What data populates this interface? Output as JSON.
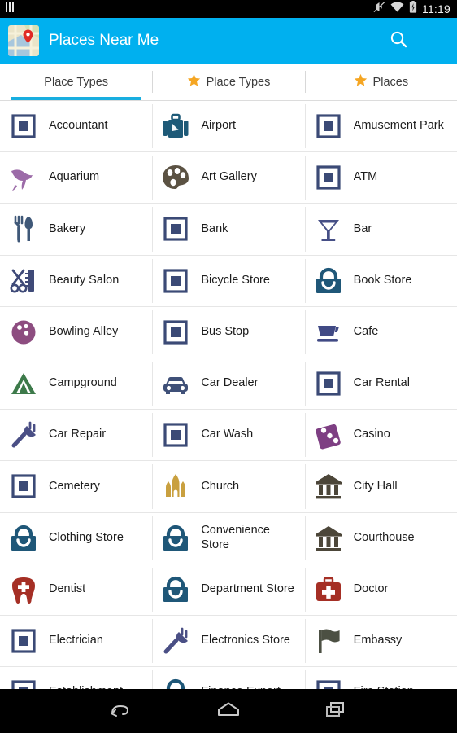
{
  "status_bar": {
    "time": "11:19",
    "icons": [
      "vibrate-muted-icon",
      "wifi-icon",
      "battery-charging-icon"
    ],
    "left_icon": "notification-bars-icon"
  },
  "app_bar": {
    "title": "Places Near Me",
    "logo_icon": "map-pin-app-icon",
    "background_color": "#00b0ef",
    "actions": [
      {
        "name": "search-button",
        "icon": "search-icon"
      },
      {
        "name": "overflow-menu-button",
        "icon": "more-vertical-icon"
      }
    ]
  },
  "tabs": {
    "active_index": 0,
    "indicator_color": "#18aee0",
    "items": [
      {
        "label": "Place Types",
        "icon": null,
        "active": true
      },
      {
        "label": "Place Types",
        "icon": "star-icon",
        "active": false
      },
      {
        "label": "Places",
        "icon": "star-icon",
        "active": false
      }
    ]
  },
  "grid": {
    "columns": 3,
    "rows": [
      [
        {
          "label": "Accountant",
          "icon": "generic-square-icon",
          "color": "#3b4a76"
        },
        {
          "label": "Airport",
          "icon": "suitcase-icon",
          "color": "#1e5a78"
        },
        {
          "label": "Amusement Park",
          "icon": "generic-square-icon",
          "color": "#3b4a76"
        }
      ],
      [
        {
          "label": "Aquarium",
          "icon": "dolphin-icon",
          "color": "#9c6ba8"
        },
        {
          "label": "Art Gallery",
          "icon": "palette-icon",
          "color": "#5b5243"
        },
        {
          "label": "ATM",
          "icon": "generic-square-icon",
          "color": "#3b4a76"
        }
      ],
      [
        {
          "label": "Bakery",
          "icon": "fork-knife-icon",
          "color": "#3f5878"
        },
        {
          "label": "Bank",
          "icon": "generic-square-icon",
          "color": "#3b4a76"
        },
        {
          "label": "Bar",
          "icon": "cocktail-glass-icon",
          "color": "#464f86"
        }
      ],
      [
        {
          "label": "Beauty Salon",
          "icon": "scissors-comb-icon",
          "color": "#3f4a78"
        },
        {
          "label": "Bicycle Store",
          "icon": "generic-square-icon",
          "color": "#3b4a76"
        },
        {
          "label": "Book Store",
          "icon": "shopping-bag-icon",
          "color": "#1f5778"
        }
      ],
      [
        {
          "label": "Bowling Alley",
          "icon": "bowling-ball-icon",
          "color": "#8d4d80"
        },
        {
          "label": "Bus Stop",
          "icon": "generic-square-icon",
          "color": "#3b4a76"
        },
        {
          "label": "Cafe",
          "icon": "coffee-cup-icon",
          "color": "#414a85"
        }
      ],
      [
        {
          "label": "Campground",
          "icon": "tent-icon",
          "color": "#3d7a4a"
        },
        {
          "label": "Car Dealer",
          "icon": "car-icon",
          "color": "#3f5078"
        },
        {
          "label": "Car Rental",
          "icon": "generic-square-icon",
          "color": "#3b4a76"
        }
      ],
      [
        {
          "label": "Car Repair",
          "icon": "power-plug-icon",
          "color": "#4a4f85"
        },
        {
          "label": "Car Wash",
          "icon": "generic-square-icon",
          "color": "#3b4a76"
        },
        {
          "label": "Casino",
          "icon": "dice-icon",
          "color": "#7e3f83"
        }
      ],
      [
        {
          "label": "Cemetery",
          "icon": "generic-square-icon",
          "color": "#3b4a76"
        },
        {
          "label": "Church",
          "icon": "church-icon",
          "color": "#c9a03f"
        },
        {
          "label": "City Hall",
          "icon": "classical-building-icon",
          "color": "#4c4639"
        }
      ],
      [
        {
          "label": "Clothing Store",
          "icon": "shopping-bag-icon",
          "color": "#1f5778"
        },
        {
          "label": "Convenience Store",
          "icon": "shopping-bag-icon",
          "color": "#1f5778"
        },
        {
          "label": "Courthouse",
          "icon": "classical-building-icon",
          "color": "#4c4639"
        }
      ],
      [
        {
          "label": "Dentist",
          "icon": "tooth-icon",
          "color": "#a52f25"
        },
        {
          "label": "Department Store",
          "icon": "shopping-bag-icon",
          "color": "#1f5778"
        },
        {
          "label": "Doctor",
          "icon": "first-aid-kit-icon",
          "color": "#a52f25"
        }
      ],
      [
        {
          "label": "Electrician",
          "icon": "generic-square-icon",
          "color": "#3b4a76"
        },
        {
          "label": "Electronics Store",
          "icon": "power-plug-icon",
          "color": "#4a4f85"
        },
        {
          "label": "Embassy",
          "icon": "flag-icon",
          "color": "#4c5043"
        }
      ],
      [
        {
          "label": "Establishment",
          "icon": "generic-square-icon",
          "color": "#3b4a76"
        },
        {
          "label": "Finance Expert",
          "icon": "shopping-bag-icon",
          "color": "#1f5778"
        },
        {
          "label": "Fire Station",
          "icon": "generic-square-icon",
          "color": "#3b4a76"
        }
      ]
    ]
  },
  "nav_bar": {
    "buttons": [
      {
        "name": "back-button",
        "icon": "back-arrow-icon"
      },
      {
        "name": "home-button",
        "icon": "home-icon"
      },
      {
        "name": "recents-button",
        "icon": "recents-icon"
      }
    ]
  }
}
